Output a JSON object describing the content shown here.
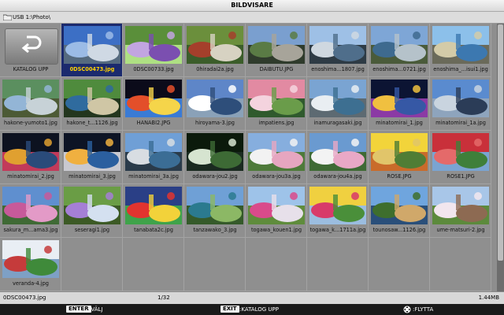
{
  "window": {
    "title": "BILDVISARE"
  },
  "path": {
    "text": "USB 1:\\Photo\\"
  },
  "up_button": {
    "label": "KATALOG UPP"
  },
  "files": [
    {
      "name": "0DSC00473.jpg",
      "selected": true
    },
    {
      "name": "0DSC00733.jpg"
    },
    {
      "name": "0hiradai2a.jpg"
    },
    {
      "name": "DAIBUTU.JPG"
    },
    {
      "name": "enoshima...1807.jpg"
    },
    {
      "name": "enoshima...0721.jpg"
    },
    {
      "name": "enoshima_...isui1.jpg"
    },
    {
      "name": "hakone-yumoto1.jpg"
    },
    {
      "name": "hakone_t...1126.jpg"
    },
    {
      "name": "HANABI2.JPG"
    },
    {
      "name": "hiroyama-3.jpg"
    },
    {
      "name": "impatiens.jpg"
    },
    {
      "name": "inamuragasaki.jpg"
    },
    {
      "name": "minatomirai_1.jpg"
    },
    {
      "name": "minatomirai_1a.jpg"
    },
    {
      "name": "minatomirai_2.jpg"
    },
    {
      "name": "minatomirai_3.jpg"
    },
    {
      "name": "minatomirai_3a.jpg"
    },
    {
      "name": "odawara-jou2.jpg"
    },
    {
      "name": "odawara-jou3a.jpg"
    },
    {
      "name": "odawara-jou4a.jpg"
    },
    {
      "name": "ROSE.JPG"
    },
    {
      "name": "ROSE1.JPG"
    },
    {
      "name": "sakura_m...ama3.jpg"
    },
    {
      "name": "seseragi1.jpg"
    },
    {
      "name": "tanabata2c.jpg"
    },
    {
      "name": "tanzawako_3.jpg"
    },
    {
      "name": "togawa_kouen1.jpg"
    },
    {
      "name": "togawa_k...1711a.jpg"
    },
    {
      "name": "tounosaw...1126.jpg"
    },
    {
      "name": "ume-matsuri-2.jpg"
    },
    {
      "name": "veranda-4.jpg"
    }
  ],
  "status": {
    "filename": "0DSC00473.jpg",
    "page": "1/32",
    "size": "1.44MB"
  },
  "keys": {
    "enter_key": "ENTER",
    "enter_text": ":VÄLJ",
    "exit_key": "EXIT",
    "exit_text": ":KATALOG UPP",
    "move_text": ":FLYTTA"
  }
}
